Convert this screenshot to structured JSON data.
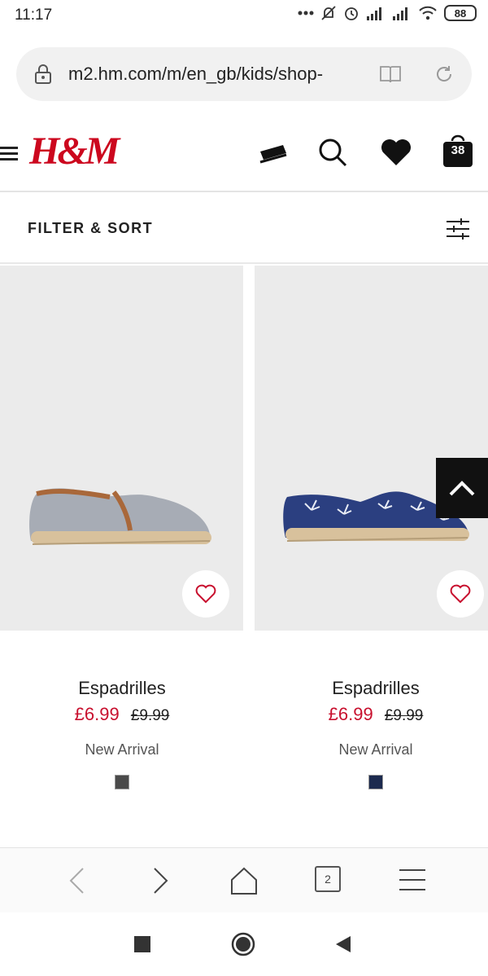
{
  "status_bar": {
    "time": "11:17",
    "battery": "88",
    "icons": [
      "more-dots-icon",
      "do-not-disturb-icon",
      "alarm-icon",
      "signal-icon",
      "signal-icon",
      "wifi-icon",
      "battery-icon"
    ]
  },
  "browser": {
    "url": "m2.hm.com/m/en_gb/kids/shop-",
    "tab_count": "2"
  },
  "header": {
    "logo": "H&M",
    "bag_count": "38",
    "brand_color": "#cc071e"
  },
  "filter": {
    "label": "FILTER & SORT"
  },
  "products": [
    {
      "name": "Espadrilles",
      "price": "£6.99",
      "old_price": "£9.99",
      "marker": "New Arrival",
      "swatch_color": "#4a4a4a"
    },
    {
      "name": "Espadrilles",
      "price": "£6.99",
      "old_price": "£9.99",
      "marker": "New Arrival",
      "swatch_color": "#1c2a4e"
    }
  ],
  "colors": {
    "sale_price": "#c8102e",
    "image_background": "#ebebeb"
  }
}
